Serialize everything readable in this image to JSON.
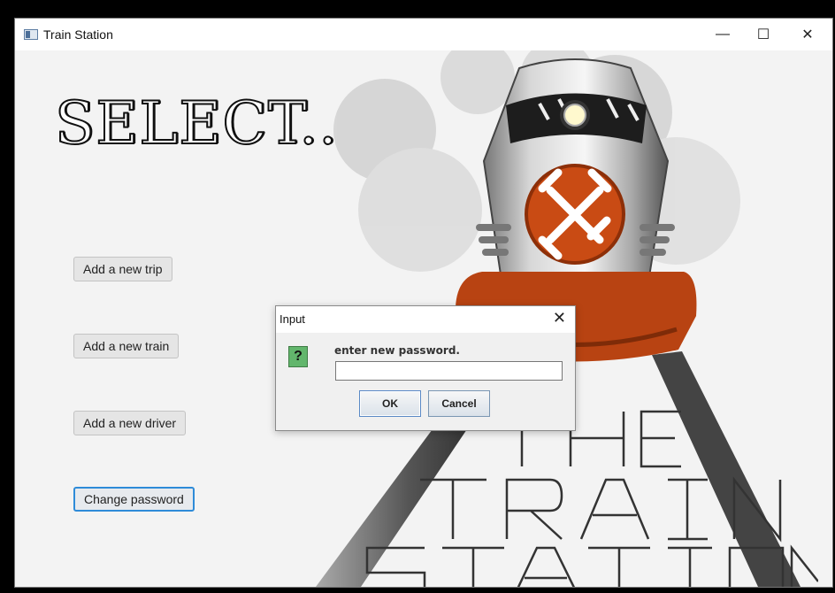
{
  "window": {
    "title": "Train Station",
    "title_icon": "java-window-icon",
    "minimize_label": "—",
    "maximize_label": "☐",
    "close_label": "✕"
  },
  "main": {
    "heading": "SELECT..",
    "buttons": [
      "Add a new trip",
      "Add a new train",
      "Add a new driver",
      "Change password"
    ],
    "focused_button": "Change password"
  },
  "poster": {
    "lines": [
      "THE",
      "TRAIN",
      "STATION"
    ],
    "emblem_icon": "crossed-dumbbell-emblem",
    "colors": {
      "orange": "#c94b14",
      "dark": "#444444"
    }
  },
  "dialog": {
    "title": "Input",
    "close_label": "✕",
    "prompt": "enter new password.",
    "input_value": "",
    "ok_label": "OK",
    "cancel_label": "Cancel",
    "icon": "question-icon",
    "icon_glyph": "?"
  }
}
